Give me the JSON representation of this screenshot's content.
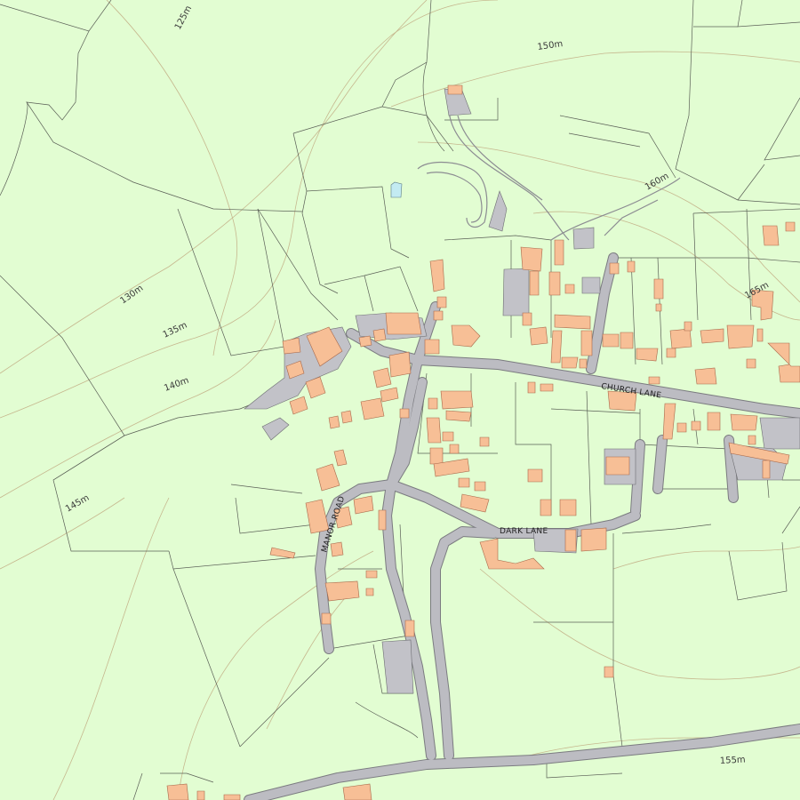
{
  "map": {
    "background_color": "#e2fdd2",
    "road_color": "#bcbcc2",
    "building_color": "#f7bf96",
    "contour_color": "#c6b78e",
    "water_color": "#c3ebf2"
  },
  "road_names": {
    "church_lane": "CHURCH LANE",
    "dark_lane": "DARK LANE",
    "manor_road": "MANOR ROAD"
  },
  "contour_labels": {
    "c125": "125m",
    "c130": "130m",
    "c135": "135m",
    "c140": "140m",
    "c145": "145m",
    "c150": "150m",
    "c155": "155m",
    "c160": "160m",
    "c165": "165m"
  }
}
